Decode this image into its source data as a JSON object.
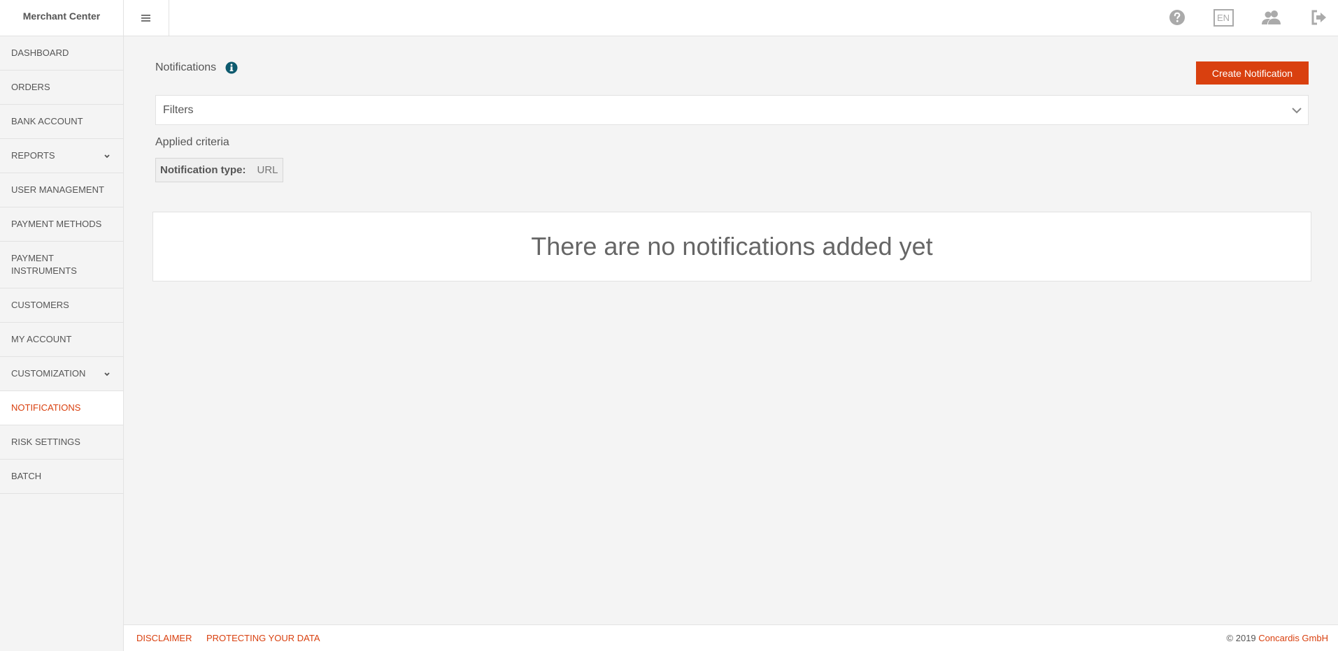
{
  "sidebar": {
    "brand": "Merchant Center",
    "items": [
      {
        "label": "DASHBOARD"
      },
      {
        "label": "ORDERS"
      },
      {
        "label": "BANK ACCOUNT"
      },
      {
        "label": "REPORTS",
        "icon": "chevron-down-icon"
      },
      {
        "label": "USER MANAGEMENT"
      },
      {
        "label": "PAYMENT METHODS"
      },
      {
        "label": "PAYMENT INSTRUMENTS"
      },
      {
        "label": "CUSTOMERS"
      },
      {
        "label": "MY ACCOUNT"
      },
      {
        "label": "CUSTOMIZATION",
        "icon": "chevron-down-icon"
      },
      {
        "label": "NOTIFICATIONS",
        "active": true
      },
      {
        "label": "RISK SETTINGS"
      },
      {
        "label": "BATCH"
      }
    ]
  },
  "topbar": {
    "menu_icon": "hamburger-icon",
    "help_icon": "help-icon",
    "language": "EN",
    "users_icon": "users-icon",
    "logout_icon": "logout-icon"
  },
  "main": {
    "title": "Notifications",
    "create_button": "Create Notification",
    "filters_label": "Filters",
    "applied_criteria_label": "Applied criteria",
    "criteria": {
      "key": "Notification type:",
      "value": "URL"
    },
    "empty_message": "There are no notifications added yet"
  },
  "footer": {
    "disclaimer": "DISCLAIMER",
    "protecting": "PROTECTING YOUR DATA",
    "copyright": "© 2019",
    "company": "Concardis GmbH"
  },
  "colors": {
    "accent": "#d9400f",
    "info_icon": "#0d5a6e",
    "icon_gray": "#aaaaaa"
  }
}
